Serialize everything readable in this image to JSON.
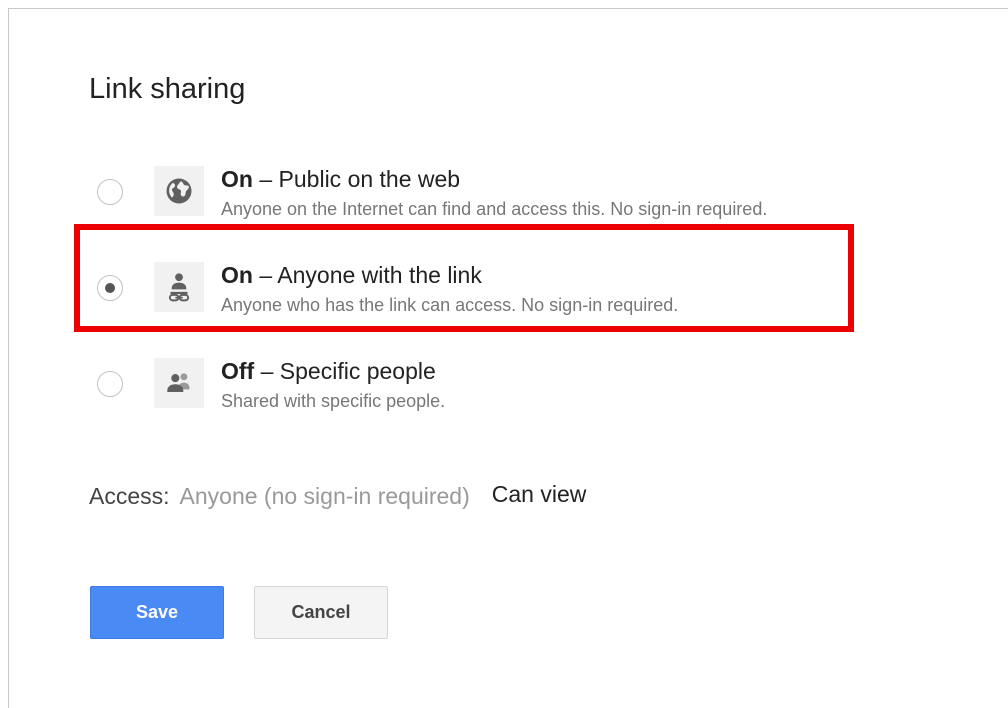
{
  "dialog": {
    "title": "Link sharing"
  },
  "options": [
    {
      "state": "On",
      "separator": "–",
      "label": "Public on the web",
      "description": "Anyone on the Internet can find and access this. No sign-in required.",
      "icon": "globe-icon",
      "selected": false
    },
    {
      "state": "On",
      "separator": "–",
      "label": "Anyone with the link",
      "description": "Anyone who has the link can access. No sign-in required.",
      "icon": "person-link-icon",
      "selected": true
    },
    {
      "state": "Off",
      "separator": "–",
      "label": "Specific people",
      "description": "Shared with specific people.",
      "icon": "people-icon",
      "selected": false
    }
  ],
  "access": {
    "label": "Access:",
    "value": "Anyone (no sign-in required)",
    "permission": "Can view"
  },
  "buttons": {
    "save": "Save",
    "cancel": "Cancel"
  },
  "colors": {
    "highlight": "#ec0000",
    "save_button": "#4a8af4"
  }
}
